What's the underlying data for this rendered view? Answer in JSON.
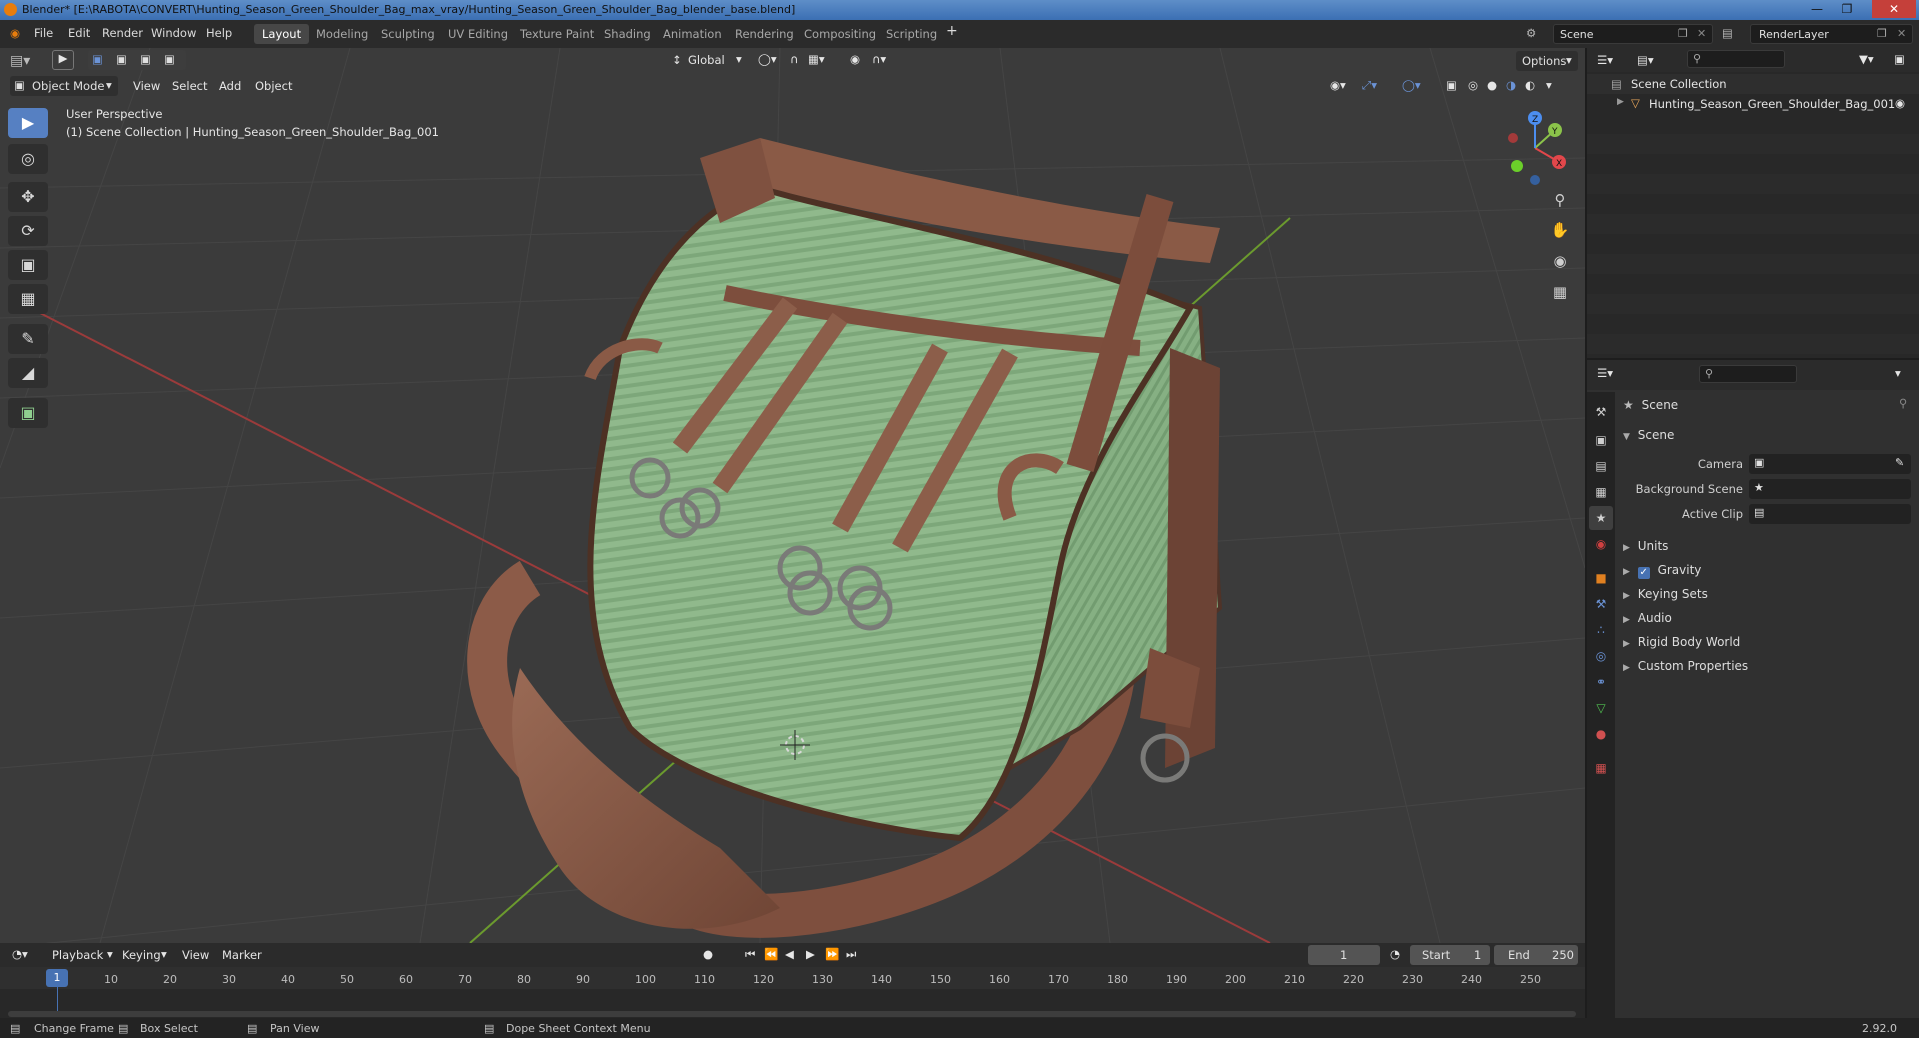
{
  "window": {
    "title": "Blender* [E:\\RABOTA\\CONVERT\\Hunting_Season_Green_Shoulder_Bag_max_vray/Hunting_Season_Green_Shoulder_Bag_blender_base.blend]",
    "controls": [
      "minimize",
      "maximize",
      "close"
    ]
  },
  "menu": {
    "items": [
      "File",
      "Edit",
      "Render",
      "Window",
      "Help"
    ],
    "workspaces": [
      "Layout",
      "Modeling",
      "Sculpting",
      "UV Editing",
      "Texture Paint",
      "Shading",
      "Animation",
      "Rendering",
      "Compositing",
      "Scripting"
    ],
    "active_workspace": "Layout",
    "add_workspace": "+",
    "scene": "Scene",
    "render_layer": "RenderLayer"
  },
  "viewport": {
    "mode": "Object Mode",
    "menus": [
      "View",
      "Select",
      "Add",
      "Object"
    ],
    "transform_orientation": "Global",
    "options_label": "Options",
    "perspective_label": "User Perspective",
    "collection_label": "(1) Scene Collection | Hunting_Season_Green_Shoulder_Bag_001",
    "gizmo_axes": [
      "X",
      "Y",
      "Z"
    ]
  },
  "outliner": {
    "root": "Scene Collection",
    "items": [
      "Hunting_Season_Green_Shoulder_Bag_001"
    ]
  },
  "properties": {
    "header": "Scene",
    "panel": "Scene",
    "fields": [
      {
        "label": "Camera",
        "value": ""
      },
      {
        "label": "Background Scene",
        "value": ""
      },
      {
        "label": "Active Clip",
        "value": ""
      }
    ],
    "sections": [
      {
        "label": "Units",
        "checkbox": false
      },
      {
        "label": "Gravity",
        "checkbox": true,
        "checked": true
      },
      {
        "label": "Keying Sets",
        "checkbox": false
      },
      {
        "label": "Audio",
        "checkbox": false
      },
      {
        "label": "Rigid Body World",
        "checkbox": false
      },
      {
        "label": "Custom Properties",
        "checkbox": false
      }
    ]
  },
  "timeline": {
    "menus": [
      "Playback",
      "Keying",
      "View",
      "Marker"
    ],
    "current_frame": "1",
    "start_label": "Start",
    "start": "1",
    "end_label": "End",
    "end": "250",
    "ticks": [
      "1",
      "10",
      "20",
      "30",
      "40",
      "50",
      "60",
      "70",
      "80",
      "90",
      "100",
      "110",
      "120",
      "130",
      "140",
      "150",
      "160",
      "170",
      "180",
      "190",
      "200",
      "210",
      "220",
      "230",
      "240",
      "250"
    ]
  },
  "status": {
    "items": [
      "Change Frame",
      "Box Select",
      "Pan View",
      "Dope Sheet Context Menu"
    ],
    "version": "2.92.0"
  },
  "colors": {
    "accent": "#4772b3",
    "header": "#2b2b2b",
    "viewport_bg": "#3b3b3b",
    "grid": "#444444",
    "x_axis": "#a33a3a",
    "y_axis": "#6a9b2c",
    "bag_fabric": "#8db58a",
    "leather": "#8a5a44"
  }
}
